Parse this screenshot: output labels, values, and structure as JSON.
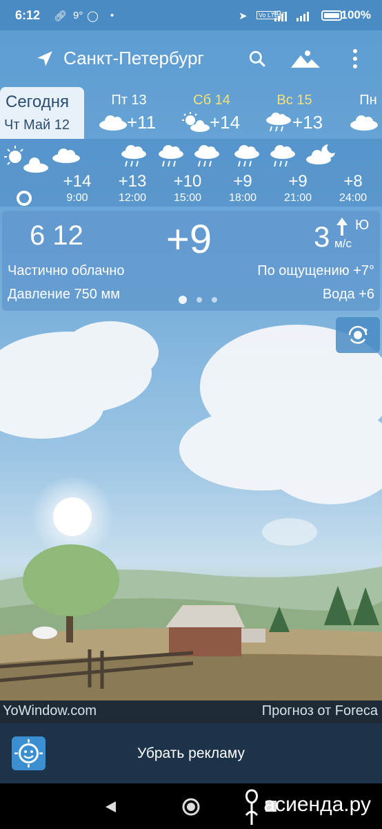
{
  "status_bar": {
    "time": "6:12",
    "indicators": [
      "link-icon",
      "temperature-9-icon",
      "whatsapp-icon",
      "dot"
    ],
    "temp_badge": "9°",
    "network": "4G+",
    "volte": "Vo LTE",
    "battery": "100%"
  },
  "toolbar": {
    "city": "Санкт-Петербург",
    "icons": [
      "location-arrow-icon",
      "search-icon",
      "landscape-icon",
      "more-vert-icon"
    ]
  },
  "days": {
    "today": {
      "label": "Сегодня",
      "date": "Чт Май 12"
    },
    "list": [
      {
        "label": "Пт 13",
        "temp": "+11",
        "icon": "partly-cloudy-icon",
        "weekend": false
      },
      {
        "label": "Сб 14",
        "temp": "+14",
        "icon": "partly-cloudy-icon",
        "weekend": true
      },
      {
        "label": "Вс 15",
        "temp": "+13",
        "icon": "rain-icon",
        "weekend": true
      },
      {
        "label": "Пн",
        "temp": "",
        "icon": "cloudy-icon",
        "weekend": false
      }
    ]
  },
  "hourly": [
    {
      "hour": "9:00",
      "temp": "+14",
      "icon": "rain-icon"
    },
    {
      "hour": "12:00",
      "temp": "+13",
      "icon": "rain-icon"
    },
    {
      "hour": "15:00",
      "temp": "+10",
      "icon": "rain-icon"
    },
    {
      "hour": "18:00",
      "temp": "+9",
      "icon": "rain-icon"
    },
    {
      "hour": "21:00",
      "temp": "+9",
      "icon": "rain-icon"
    },
    {
      "hour": "24:00",
      "temp": "+8",
      "icon": "night-cloudy-icon"
    }
  ],
  "current": {
    "time": "6 12",
    "temp": "+9",
    "wind_speed": "3",
    "wind_dir": "Ю",
    "wind_unit": "м/с",
    "condition": "Частично облачно",
    "feels_like": "По ощущению +7°",
    "pressure": "Давление 750 мм",
    "water": "Вода +6"
  },
  "credits": {
    "left": "YoWindow.com",
    "right": "Прогноз от Foreca"
  },
  "ad": {
    "remove_label": "Убрать рекламу"
  },
  "watermark": "асиенда.ру"
}
